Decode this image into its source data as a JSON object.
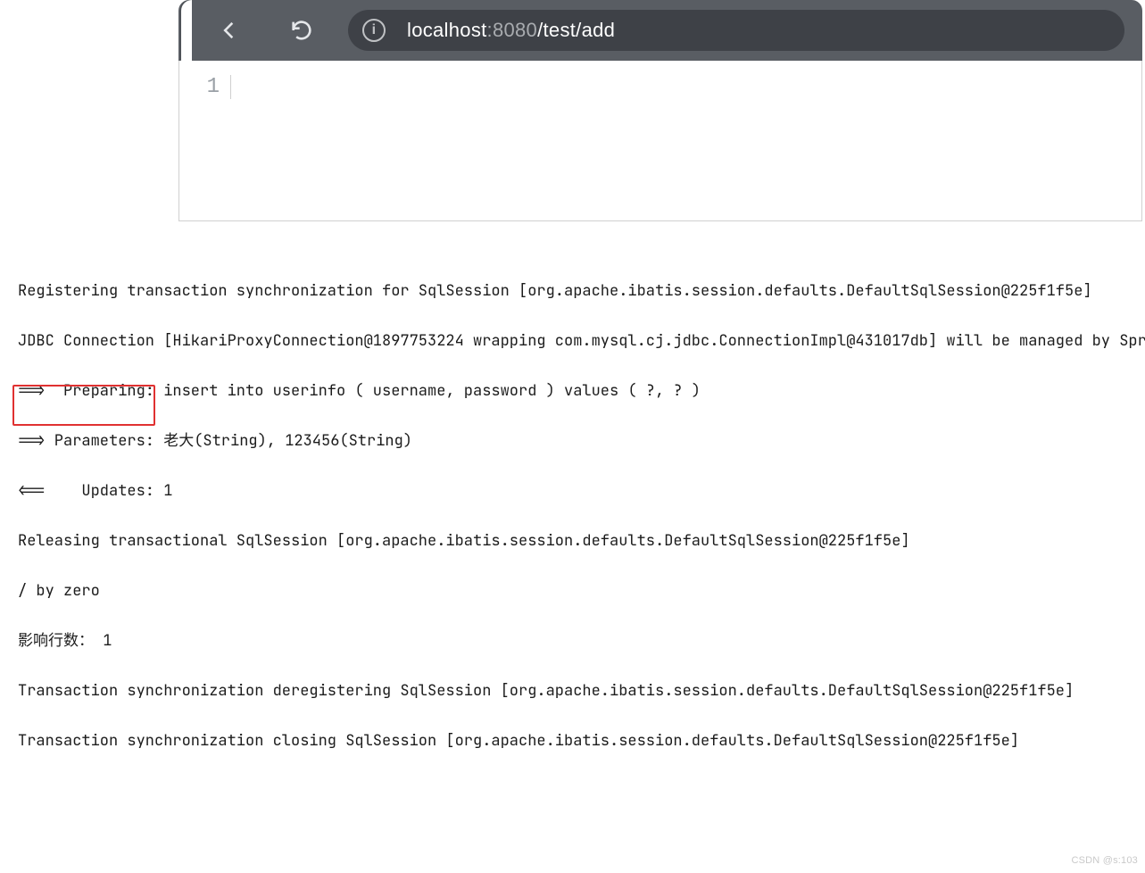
{
  "browser": {
    "url_dim_prefix": "localhost",
    "url_dim_port": ":8080",
    "url_path": "/test/add"
  },
  "page": {
    "line_number": "1",
    "body_text": ""
  },
  "log": {
    "lines": [
      "Registering transaction synchronization for SqlSession [org.apache.ibatis.session.defaults.DefaultSqlSession@225f1f5e]",
      "JDBC Connection [HikariProxyConnection@1897753224 wrapping com.mysql.cj.jdbc.ConnectionImpl@431017db] will be managed by Spring",
      "==>  Preparing: insert into userinfo ( username, password ) values ( ?, ? )",
      "==> Parameters: 老大(String), 123456(String)",
      "<==    Updates: 1",
      "Releasing transactional SqlSession [org.apache.ibatis.session.defaults.DefaultSqlSession@225f1f5e]",
      "/ by zero",
      "影响行数： 1",
      "Transaction synchronization deregistering SqlSession [org.apache.ibatis.session.defaults.DefaultSqlSession@225f1f5e]",
      "Transaction synchronization closing SqlSession [org.apache.ibatis.session.defaults.DefaultSqlSession@225f1f5e]"
    ]
  },
  "watermark": "CSDN @s:103"
}
